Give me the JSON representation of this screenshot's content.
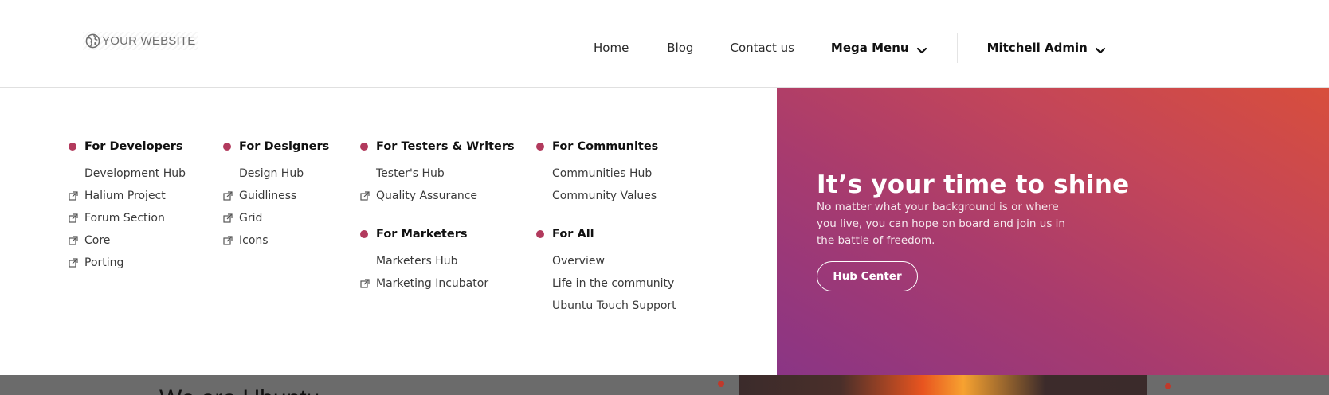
{
  "header": {
    "logo_text": "YOUR WEBSITE",
    "nav": {
      "home": "Home",
      "blog": "Blog",
      "contact": "Contact us",
      "mega_menu": "Mega Menu",
      "user": "Mitchell Admin"
    }
  },
  "mega_menu": {
    "accent_color": "#b23a5d",
    "columns": [
      {
        "groups": [
          {
            "heading": "For Developers",
            "items": [
              {
                "label": "Development Hub",
                "external": false
              },
              {
                "label": "Halium Project",
                "external": true
              },
              {
                "label": "Forum Section",
                "external": true
              },
              {
                "label": "Core",
                "external": true
              },
              {
                "label": "Porting",
                "external": true
              }
            ]
          }
        ]
      },
      {
        "groups": [
          {
            "heading": "For Designers",
            "items": [
              {
                "label": "Design Hub",
                "external": false
              },
              {
                "label": "Guidliness",
                "external": true
              },
              {
                "label": "Grid",
                "external": true
              },
              {
                "label": "Icons",
                "external": true
              }
            ]
          }
        ]
      },
      {
        "groups": [
          {
            "heading": "For Testers & Writers",
            "items": [
              {
                "label": "Tester's Hub",
                "external": false
              },
              {
                "label": "Quality Assurance",
                "external": true
              }
            ]
          },
          {
            "heading": "For Marketers",
            "items": [
              {
                "label": "Marketers Hub",
                "external": false
              },
              {
                "label": "Marketing Incubator",
                "external": true
              }
            ]
          }
        ]
      },
      {
        "groups": [
          {
            "heading": "For Communites",
            "items": [
              {
                "label": "Communities Hub",
                "external": false
              },
              {
                "label": "Community Values",
                "external": false
              }
            ]
          },
          {
            "heading": "For All",
            "items": [
              {
                "label": "Overview",
                "external": false
              },
              {
                "label": "Life in the community",
                "external": false
              },
              {
                "label": "Ubuntu Touch Support",
                "external": false
              }
            ]
          }
        ]
      }
    ]
  },
  "hero": {
    "title": "It’s your time to shine",
    "text": "No matter what your background is or where you live, you can hope on board and join us in the battle of freedom.",
    "button": "Hub Center",
    "gradient_start": "#8a3585",
    "gradient_end": "#d84e3c"
  },
  "background": {
    "heading_partial": "We are Ubuntu"
  }
}
